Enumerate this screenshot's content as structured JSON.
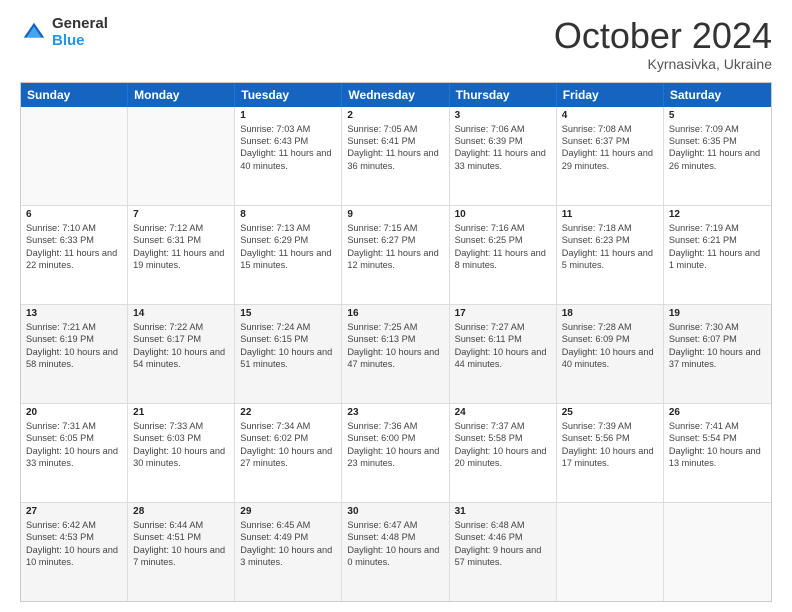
{
  "header": {
    "logo_general": "General",
    "logo_blue": "Blue",
    "month_title": "October 2024",
    "location": "Kyrnasivka, Ukraine"
  },
  "days_of_week": [
    "Sunday",
    "Monday",
    "Tuesday",
    "Wednesday",
    "Thursday",
    "Friday",
    "Saturday"
  ],
  "weeks": [
    [
      {
        "day": "",
        "info": "",
        "empty": true
      },
      {
        "day": "",
        "info": "",
        "empty": true
      },
      {
        "day": "1",
        "info": "Sunrise: 7:03 AM\nSunset: 6:43 PM\nDaylight: 11 hours and 40 minutes."
      },
      {
        "day": "2",
        "info": "Sunrise: 7:05 AM\nSunset: 6:41 PM\nDaylight: 11 hours and 36 minutes."
      },
      {
        "day": "3",
        "info": "Sunrise: 7:06 AM\nSunset: 6:39 PM\nDaylight: 11 hours and 33 minutes."
      },
      {
        "day": "4",
        "info": "Sunrise: 7:08 AM\nSunset: 6:37 PM\nDaylight: 11 hours and 29 minutes."
      },
      {
        "day": "5",
        "info": "Sunrise: 7:09 AM\nSunset: 6:35 PM\nDaylight: 11 hours and 26 minutes."
      }
    ],
    [
      {
        "day": "6",
        "info": "Sunrise: 7:10 AM\nSunset: 6:33 PM\nDaylight: 11 hours and 22 minutes."
      },
      {
        "day": "7",
        "info": "Sunrise: 7:12 AM\nSunset: 6:31 PM\nDaylight: 11 hours and 19 minutes."
      },
      {
        "day": "8",
        "info": "Sunrise: 7:13 AM\nSunset: 6:29 PM\nDaylight: 11 hours and 15 minutes."
      },
      {
        "day": "9",
        "info": "Sunrise: 7:15 AM\nSunset: 6:27 PM\nDaylight: 11 hours and 12 minutes."
      },
      {
        "day": "10",
        "info": "Sunrise: 7:16 AM\nSunset: 6:25 PM\nDaylight: 11 hours and 8 minutes."
      },
      {
        "day": "11",
        "info": "Sunrise: 7:18 AM\nSunset: 6:23 PM\nDaylight: 11 hours and 5 minutes."
      },
      {
        "day": "12",
        "info": "Sunrise: 7:19 AM\nSunset: 6:21 PM\nDaylight: 11 hours and 1 minute."
      }
    ],
    [
      {
        "day": "13",
        "info": "Sunrise: 7:21 AM\nSunset: 6:19 PM\nDaylight: 10 hours and 58 minutes.",
        "alt": true
      },
      {
        "day": "14",
        "info": "Sunrise: 7:22 AM\nSunset: 6:17 PM\nDaylight: 10 hours and 54 minutes.",
        "alt": true
      },
      {
        "day": "15",
        "info": "Sunrise: 7:24 AM\nSunset: 6:15 PM\nDaylight: 10 hours and 51 minutes.",
        "alt": true
      },
      {
        "day": "16",
        "info": "Sunrise: 7:25 AM\nSunset: 6:13 PM\nDaylight: 10 hours and 47 minutes.",
        "alt": true
      },
      {
        "day": "17",
        "info": "Sunrise: 7:27 AM\nSunset: 6:11 PM\nDaylight: 10 hours and 44 minutes.",
        "alt": true
      },
      {
        "day": "18",
        "info": "Sunrise: 7:28 AM\nSunset: 6:09 PM\nDaylight: 10 hours and 40 minutes.",
        "alt": true
      },
      {
        "day": "19",
        "info": "Sunrise: 7:30 AM\nSunset: 6:07 PM\nDaylight: 10 hours and 37 minutes.",
        "alt": true
      }
    ],
    [
      {
        "day": "20",
        "info": "Sunrise: 7:31 AM\nSunset: 6:05 PM\nDaylight: 10 hours and 33 minutes."
      },
      {
        "day": "21",
        "info": "Sunrise: 7:33 AM\nSunset: 6:03 PM\nDaylight: 10 hours and 30 minutes."
      },
      {
        "day": "22",
        "info": "Sunrise: 7:34 AM\nSunset: 6:02 PM\nDaylight: 10 hours and 27 minutes."
      },
      {
        "day": "23",
        "info": "Sunrise: 7:36 AM\nSunset: 6:00 PM\nDaylight: 10 hours and 23 minutes."
      },
      {
        "day": "24",
        "info": "Sunrise: 7:37 AM\nSunset: 5:58 PM\nDaylight: 10 hours and 20 minutes."
      },
      {
        "day": "25",
        "info": "Sunrise: 7:39 AM\nSunset: 5:56 PM\nDaylight: 10 hours and 17 minutes."
      },
      {
        "day": "26",
        "info": "Sunrise: 7:41 AM\nSunset: 5:54 PM\nDaylight: 10 hours and 13 minutes."
      }
    ],
    [
      {
        "day": "27",
        "info": "Sunrise: 6:42 AM\nSunset: 4:53 PM\nDaylight: 10 hours and 10 minutes.",
        "alt": true
      },
      {
        "day": "28",
        "info": "Sunrise: 6:44 AM\nSunset: 4:51 PM\nDaylight: 10 hours and 7 minutes.",
        "alt": true
      },
      {
        "day": "29",
        "info": "Sunrise: 6:45 AM\nSunset: 4:49 PM\nDaylight: 10 hours and 3 minutes.",
        "alt": true
      },
      {
        "day": "30",
        "info": "Sunrise: 6:47 AM\nSunset: 4:48 PM\nDaylight: 10 hours and 0 minutes.",
        "alt": true
      },
      {
        "day": "31",
        "info": "Sunrise: 6:48 AM\nSunset: 4:46 PM\nDaylight: 9 hours and 57 minutes.",
        "alt": true
      },
      {
        "day": "",
        "info": "",
        "empty": true,
        "alt": true
      },
      {
        "day": "",
        "info": "",
        "empty": true,
        "alt": true
      }
    ]
  ]
}
